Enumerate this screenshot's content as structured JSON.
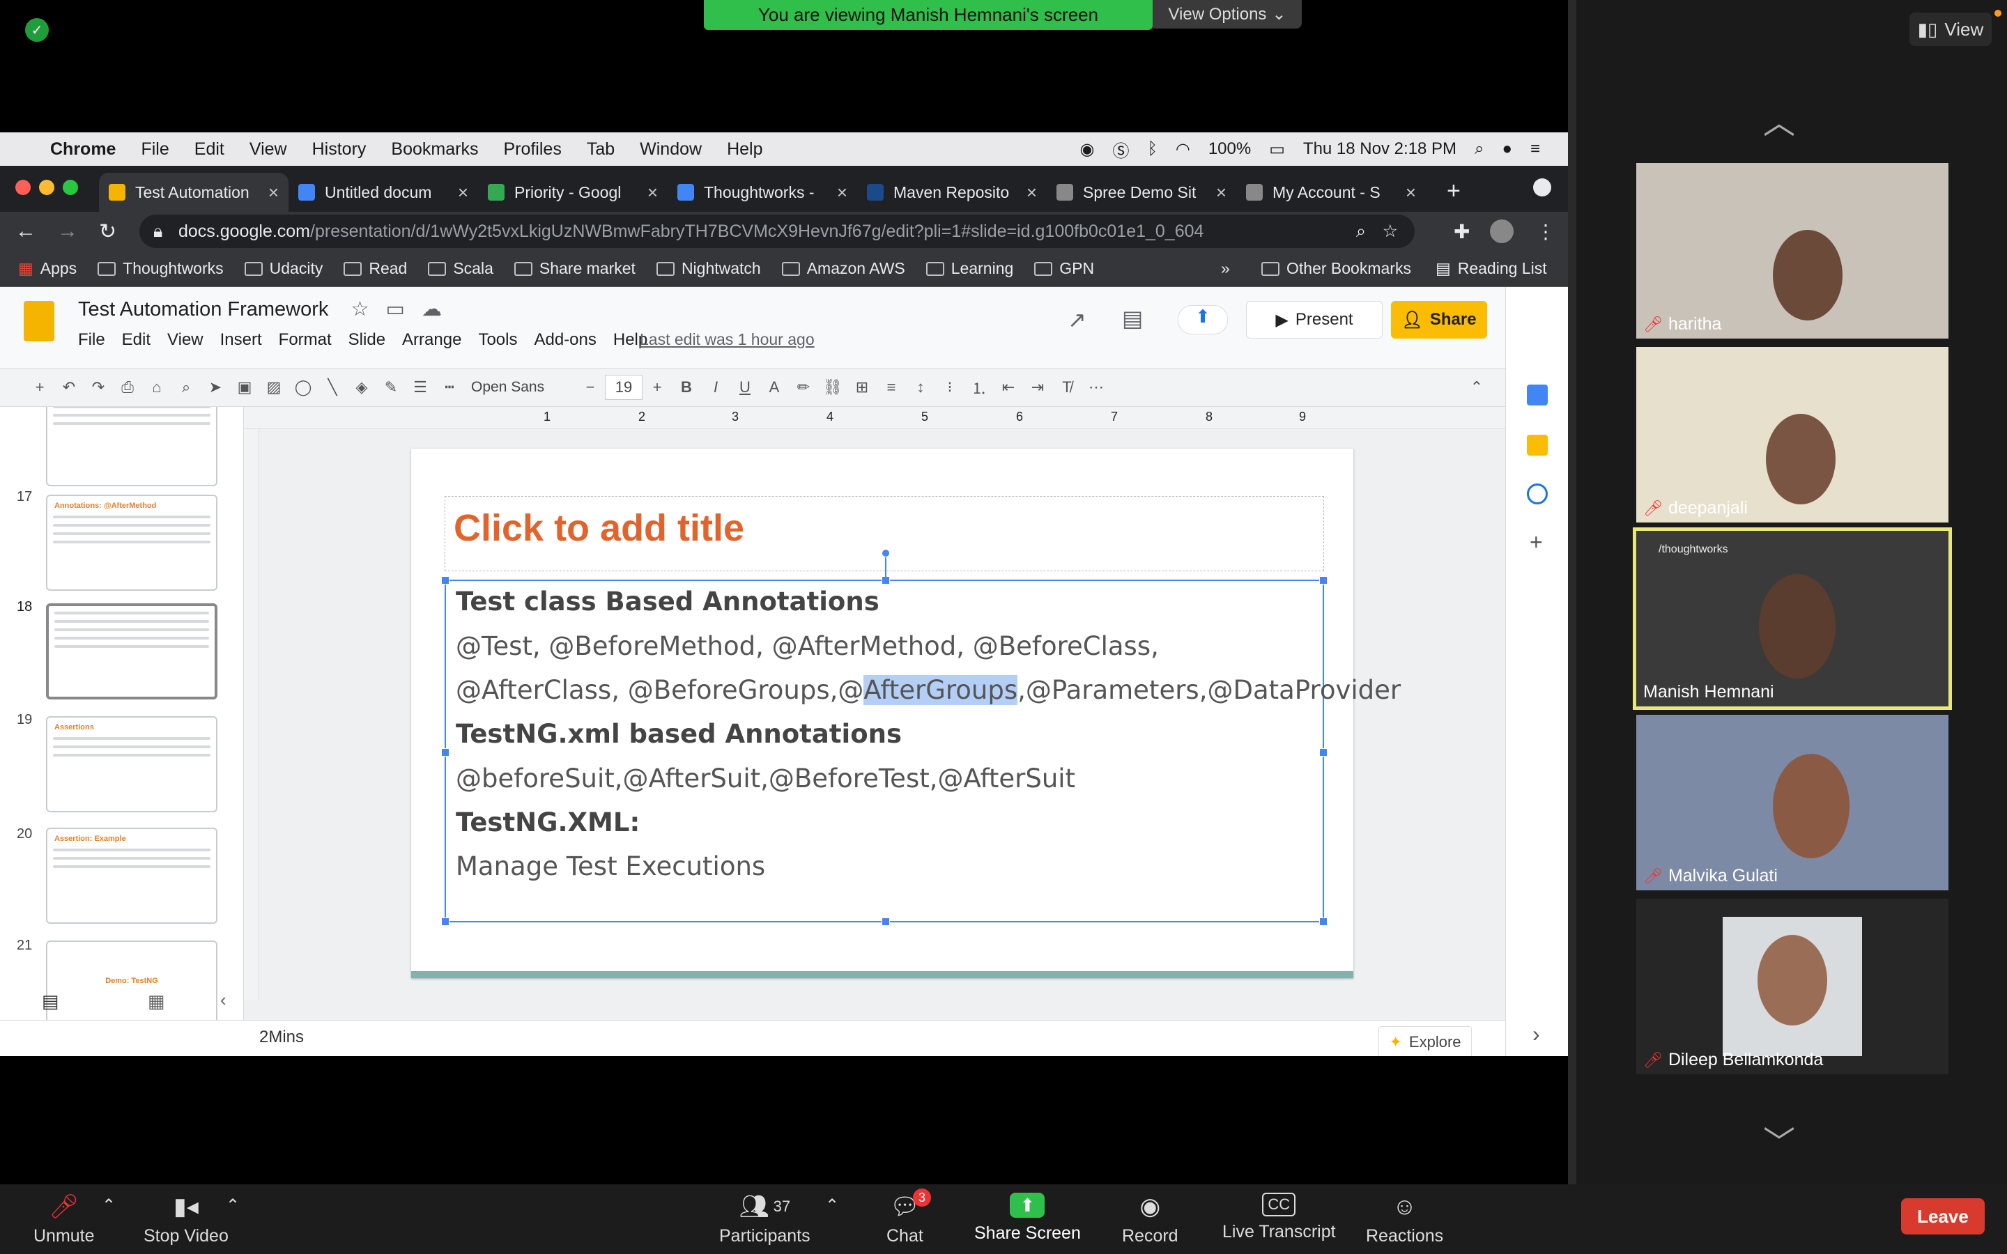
{
  "zoom": {
    "banner_text": "You are viewing Manish Hemnani's screen",
    "view_options_label": "View Options",
    "view_label": "View",
    "participants_count": "37",
    "chat_badge": "3",
    "toolbar": [
      {
        "key": "unmute",
        "label": "Unmute",
        "icon": "mic-muted-icon"
      },
      {
        "key": "stop_video",
        "label": "Stop Video",
        "icon": "video-camera-icon"
      },
      {
        "key": "participants",
        "label": "Participants",
        "icon": "participants-icon"
      },
      {
        "key": "chat",
        "label": "Chat",
        "icon": "chat-icon"
      },
      {
        "key": "share_screen",
        "label": "Share Screen",
        "icon": "share-screen-icon"
      },
      {
        "key": "record",
        "label": "Record",
        "icon": "record-icon"
      },
      {
        "key": "live_transcript",
        "label": "Live Transcript",
        "icon": "cc-icon"
      },
      {
        "key": "reactions",
        "label": "Reactions",
        "icon": "reactions-icon"
      }
    ],
    "leave_label": "Leave",
    "participants": [
      {
        "name": "haritha",
        "muted": true
      },
      {
        "name": "deepanjali",
        "muted": true
      },
      {
        "name": "Manish Hemnani",
        "muted": false,
        "active": true
      },
      {
        "name": "Malvika Gulati",
        "muted": true
      },
      {
        "name": "Dileep Bellamkonda",
        "muted": true
      }
    ],
    "video_overlay_text": "/thoughtworks"
  },
  "mac_menu": {
    "app": "Chrome",
    "items": [
      "File",
      "Edit",
      "View",
      "History",
      "Bookmarks",
      "Profiles",
      "Tab",
      "Window",
      "Help"
    ],
    "battery": "100%",
    "clock": "Thu 18 Nov  2:18 PM"
  },
  "chrome": {
    "tabs": [
      {
        "title": "Test Automation",
        "active": true,
        "color": "#f4b400"
      },
      {
        "title": "Untitled docum",
        "color": "#4285f4"
      },
      {
        "title": "Priority - Googl",
        "color": "#34a853"
      },
      {
        "title": "Thoughtworks -",
        "color": "#4285f4"
      },
      {
        "title": "Maven Reposito",
        "color": "#1a4a8a"
      },
      {
        "title": "Spree Demo Sit",
        "color": "#888"
      },
      {
        "title": "My Account - S",
        "color": "#888"
      }
    ],
    "url_host": "docs.google.com",
    "url_path": "/presentation/d/1wWy2t5vxLkigUzNWBmwFabryTH7BCVMcX9HevnJf67g/edit?pli=1#slide=id.g100fb0c01e1_0_604",
    "bookmarks": [
      "Apps",
      "Thoughtworks",
      "Udacity",
      "Read",
      "Scala",
      "Share market",
      "Nightwatch",
      "Amazon AWS",
      "Learning",
      "GPN"
    ],
    "bookmarks_more": "»",
    "other_bookmarks": "Other Bookmarks",
    "reading_list": "Reading List"
  },
  "slides": {
    "doc_title": "Test Automation Framework",
    "menu": [
      "File",
      "Edit",
      "View",
      "Insert",
      "Format",
      "Slide",
      "Arrange",
      "Tools",
      "Add-ons",
      "Help"
    ],
    "last_edit": "Last edit was 1 hour ago",
    "present_label": "Present",
    "share_label": "Share",
    "font_name": "Open Sans",
    "font_size": "19",
    "thumb_numbers": [
      "17",
      "18",
      "19",
      "20",
      "21"
    ],
    "thumb_titles": [
      "Annotations: @AfterMethod",
      "",
      "Assertions",
      "Assertion: Example",
      "Demo: TestNG"
    ],
    "ruler_numbers": [
      "1",
      "2",
      "3",
      "4",
      "5",
      "6",
      "7",
      "8",
      "9"
    ],
    "slide_title_placeholder": "Click to add title",
    "body_lines": [
      {
        "text": "Test class Based Annotations",
        "bold": true
      },
      {
        "text": "@Test, @BeforeMethod, @AfterMethod, @BeforeClass,",
        "bold": false
      },
      {
        "pre": "@AfterClass, @BeforeGroups,@",
        "sel": "AfterGroups",
        "post": ",@Parameters,@DataProvider",
        "bold": false
      },
      {
        "text": "TestNG.xml based Annotations",
        "bold": true
      },
      {
        "text": "@beforeSuit,@AfterSuit,@BeforeTest,@AfterSuit",
        "bold": false
      },
      {
        "text": "TestNG.XML:",
        "bold": true
      },
      {
        "text": "Manage Test Executions",
        "bold": false
      }
    ],
    "speaker_notes": "2Mins",
    "explore_label": "Explore"
  },
  "colors": {
    "accent_blue": "#4285f4",
    "title_orange": "#e0642c",
    "zoom_green": "#2fbf4a",
    "leave_red": "#d83b2d",
    "active_speaker": "#e9e67a"
  }
}
